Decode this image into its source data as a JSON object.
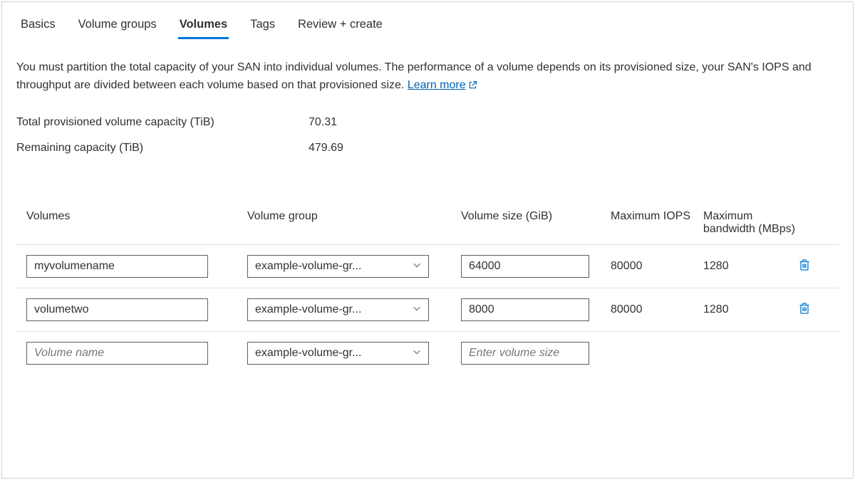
{
  "tabs": {
    "basics": "Basics",
    "volume_groups": "Volume groups",
    "volumes": "Volumes",
    "tags": "Tags",
    "review": "Review + create"
  },
  "description": {
    "text": "You must partition the total capacity of your SAN into individual volumes. The performance of a volume depends on its provisioned size, your SAN's IOPS and throughput are divided between each volume based on that provisioned size. ",
    "link": "Learn more"
  },
  "stats": {
    "total_label": "Total provisioned volume capacity (TiB)",
    "total_value": "70.31",
    "remaining_label": "Remaining capacity (TiB)",
    "remaining_value": "479.69"
  },
  "columns": {
    "volumes": "Volumes",
    "group": "Volume group",
    "size": "Volume size (GiB)",
    "iops": "Maximum IOPS",
    "bandwidth": "Maximum bandwidth (MBps)"
  },
  "placeholders": {
    "name": "Volume name",
    "size": "Enter volume size"
  },
  "rows": [
    {
      "name": "myvolumename",
      "group": "example-volume-gr...",
      "size": "64000",
      "iops": "80000",
      "bw": "1280"
    },
    {
      "name": "volumetwo",
      "group": "example-volume-gr...",
      "size": "8000",
      "iops": "80000",
      "bw": "1280"
    }
  ],
  "new_row": {
    "group": "example-volume-gr..."
  }
}
